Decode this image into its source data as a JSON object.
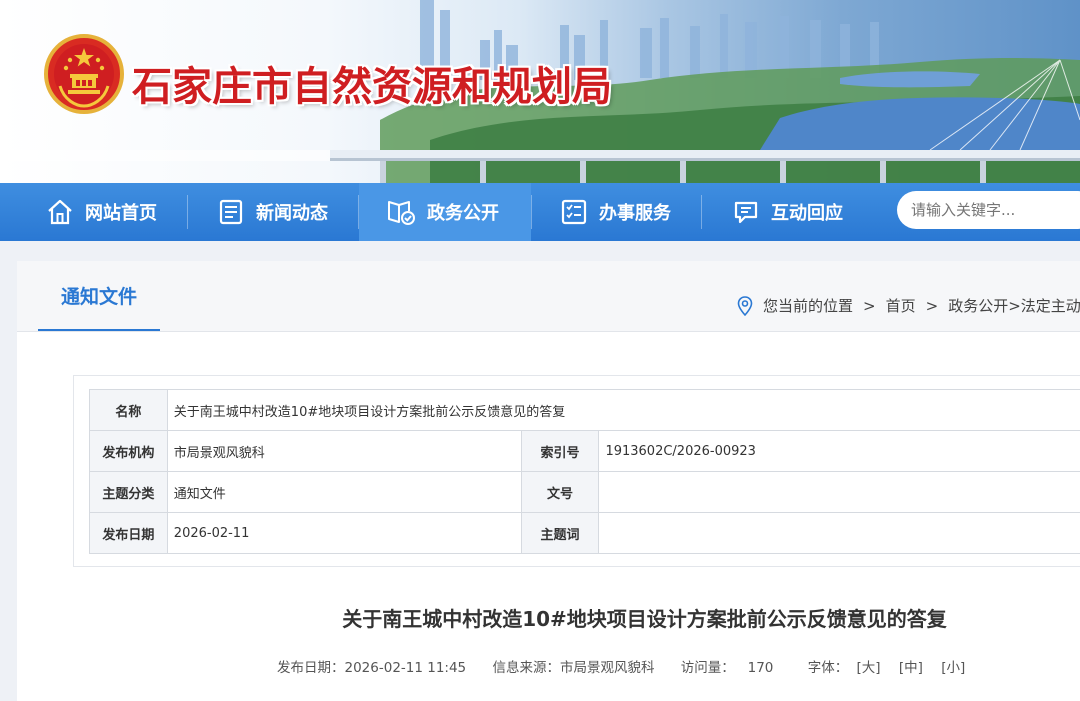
{
  "header": {
    "site_title": "石家庄市自然资源和规划局"
  },
  "nav": {
    "items": [
      {
        "label": "网站首页",
        "icon": "home-icon"
      },
      {
        "label": "新闻动态",
        "icon": "newspaper-icon"
      },
      {
        "label": "政务公开",
        "icon": "document-check-icon"
      },
      {
        "label": "办事服务",
        "icon": "checklist-icon"
      },
      {
        "label": "互动回应",
        "icon": "chat-icon"
      }
    ],
    "active_index": 2
  },
  "search": {
    "placeholder": "请输入关键字..."
  },
  "section": {
    "tab_label": "通知文件",
    "breadcrumb": {
      "prefix": "您当前的位置",
      "sep": ">",
      "home": "首页",
      "path": "政务公开>法定主动"
    }
  },
  "info_table": {
    "name_label": "名称",
    "name_value": "关于南王城中村改造10#地块项目设计方案批前公示反馈意见的答复",
    "publisher_label": "发布机构",
    "publisher_value": "市局景观风貌科",
    "index_label": "索引号",
    "index_value": "1913602C/2026-00923",
    "topic_label": "主题分类",
    "topic_value": "通知文件",
    "docno_label": "文号",
    "docno_value": "",
    "date_label": "发布日期",
    "date_value": "2026-02-11",
    "keywords_label": "主题词",
    "keywords_value": ""
  },
  "article": {
    "title": "关于南王城中村改造10#地块项目设计方案批前公示反馈意见的答复",
    "publish_date": "发布日期：2026-02-11 11:45",
    "source": "信息来源：市局景观风貌科",
    "visits": "访问量：   170",
    "font_label": "字体：",
    "font_large": "[大]",
    "font_medium": "[中]",
    "font_small": "[小]"
  }
}
